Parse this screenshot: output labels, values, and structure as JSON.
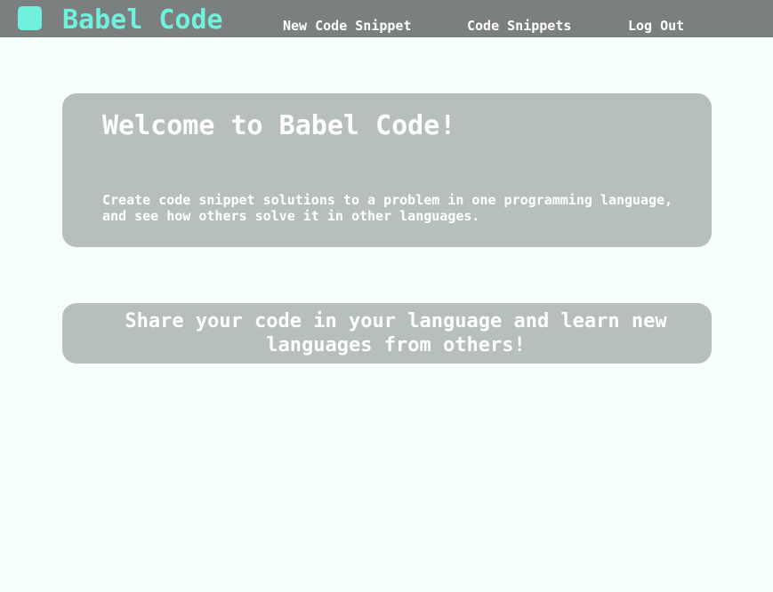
{
  "header": {
    "logo_icon": "square-logo-icon",
    "brand": "Babel Code",
    "nav": {
      "new_snippet": "New Code Snippet",
      "snippets": "Code Snippets",
      "logout": "Log Out"
    }
  },
  "main": {
    "welcome": {
      "title": "Welcome to Babel Code!",
      "description": "Create code snippet solutions to a problem in one programming language, and see how others solve it in other languages."
    },
    "share": {
      "text": "Share your code in your language and learn new languages from others!"
    }
  },
  "colors": {
    "accent": "#6ff1dd",
    "header_bg": "#7b7f7f",
    "card_bg": "#b7bfbe",
    "page_bg": "#f5fffe"
  }
}
